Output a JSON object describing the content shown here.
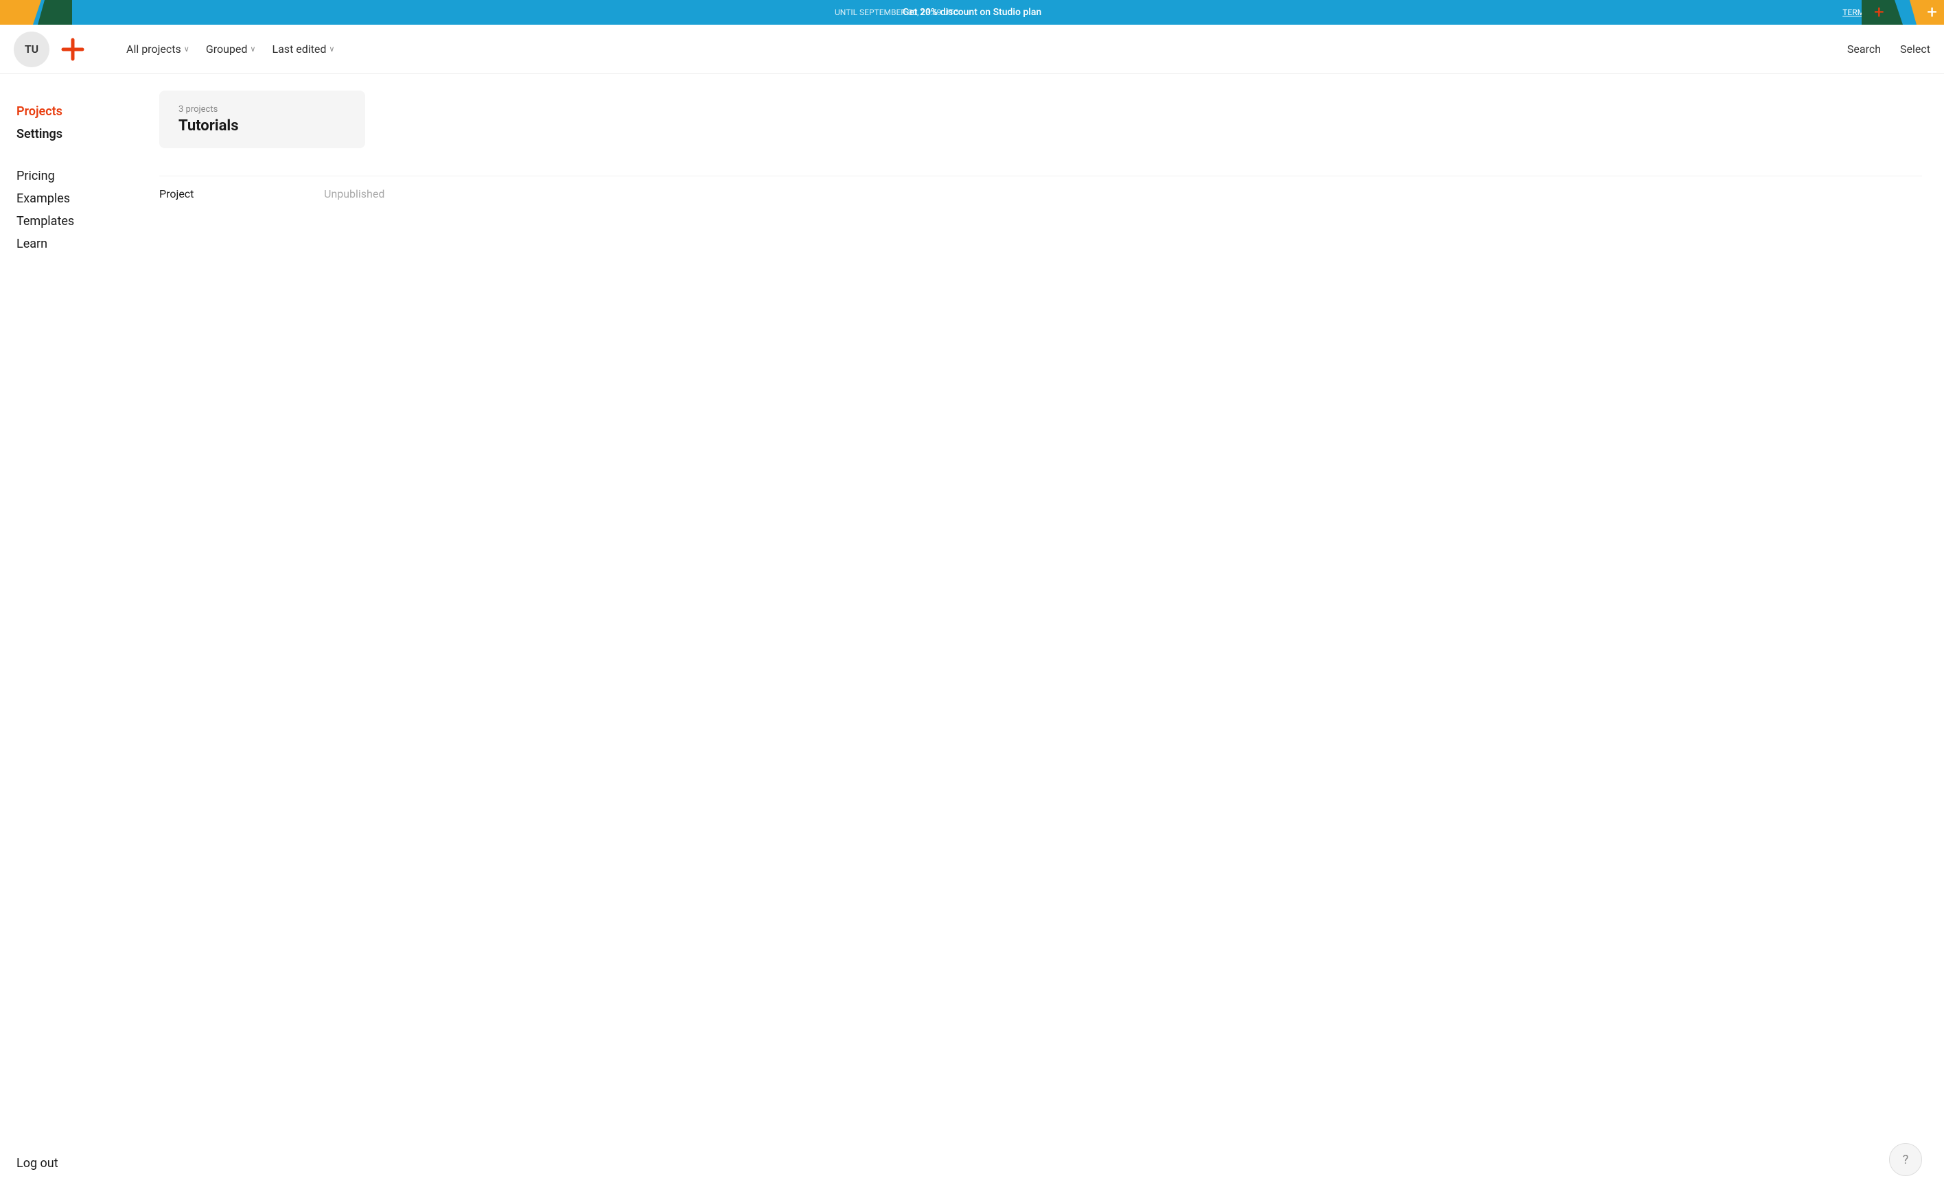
{
  "promo": {
    "until_text": "UNTIL SEPTEMBER 30, 23:59 UTC",
    "main_text": "Get 20% discount on Studio plan",
    "terms_text": "TERMS LINK"
  },
  "header": {
    "avatar_initials": "TU",
    "filters": [
      {
        "label": "All projects",
        "has_chevron": true
      },
      {
        "label": "Grouped",
        "has_chevron": true
      },
      {
        "label": "Last edited",
        "has_chevron": true
      }
    ],
    "search_label": "Search",
    "select_label": "Select"
  },
  "sidebar": {
    "nav_items": [
      {
        "label": "Projects",
        "active": true
      },
      {
        "label": "Settings",
        "active": false
      }
    ],
    "secondary_items": [
      {
        "label": "Pricing"
      },
      {
        "label": "Examples"
      },
      {
        "label": "Templates"
      },
      {
        "label": "Learn"
      }
    ],
    "logout_label": "Log out"
  },
  "main": {
    "project_group": {
      "count_label": "3 projects",
      "name": "Tutorials"
    },
    "list_columns": {
      "col1": "Project",
      "col2": "Unpublished"
    }
  },
  "help_icon": "?"
}
